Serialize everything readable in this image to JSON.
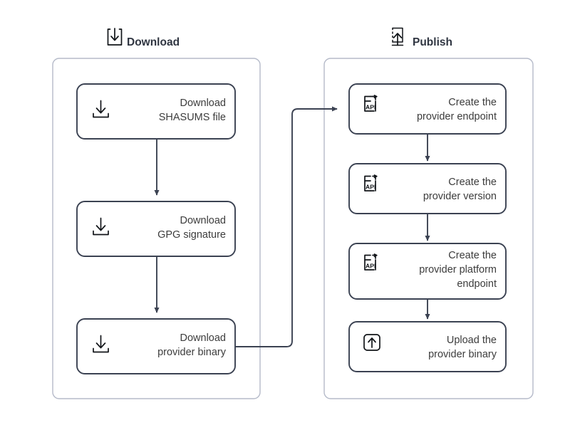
{
  "diagram": {
    "title_hidden": "",
    "colors": {
      "node_border": "#3b4252",
      "group_border": "#b5bac9",
      "text": "#3c3c3c",
      "heading": "#2f3541",
      "background": "#ffffff",
      "edge": "#3b4252"
    },
    "groups": [
      {
        "id": "download",
        "title": "Download",
        "icon": "download-box-icon",
        "nodes": [
          {
            "id": "download-shasums",
            "icon": "download-tray-icon",
            "lines": [
              "Download",
              "SHASUMS file"
            ]
          },
          {
            "id": "download-gpg",
            "icon": "download-tray-icon",
            "lines": [
              "Download",
              "GPG signature"
            ]
          },
          {
            "id": "download-binary",
            "icon": "download-tray-icon",
            "lines": [
              "Download",
              "provider binary"
            ]
          }
        ]
      },
      {
        "id": "publish",
        "title": "Publish",
        "icon": "publish-upload-box-icon",
        "nodes": [
          {
            "id": "create-provider-endpoint",
            "icon": "api-document-icon",
            "icon_label": "API",
            "lines": [
              "Create the",
              "provider endpoint"
            ]
          },
          {
            "id": "create-provider-version",
            "icon": "api-document-icon",
            "icon_label": "API",
            "lines": [
              "Create the",
              "provider version"
            ]
          },
          {
            "id": "create-provider-platform-endpoint",
            "icon": "api-document-icon",
            "icon_label": "API",
            "lines": [
              "Create the",
              "provider platform",
              "endpoint"
            ]
          },
          {
            "id": "upload-provider-binary",
            "icon": "upload-arrow-box-icon",
            "lines": [
              "Upload the",
              "provider binary"
            ]
          }
        ]
      }
    ],
    "edges": [
      {
        "id": "e1",
        "from": "download-shasums",
        "to": "download-gpg"
      },
      {
        "id": "e2",
        "from": "download-gpg",
        "to": "download-binary"
      },
      {
        "id": "e3",
        "from": "download-binary",
        "to": "create-provider-endpoint"
      },
      {
        "id": "e4",
        "from": "create-provider-endpoint",
        "to": "create-provider-version"
      },
      {
        "id": "e5",
        "from": "create-provider-version",
        "to": "create-provider-platform-endpoint"
      },
      {
        "id": "e6",
        "from": "create-provider-platform-endpoint",
        "to": "upload-provider-binary"
      }
    ]
  }
}
